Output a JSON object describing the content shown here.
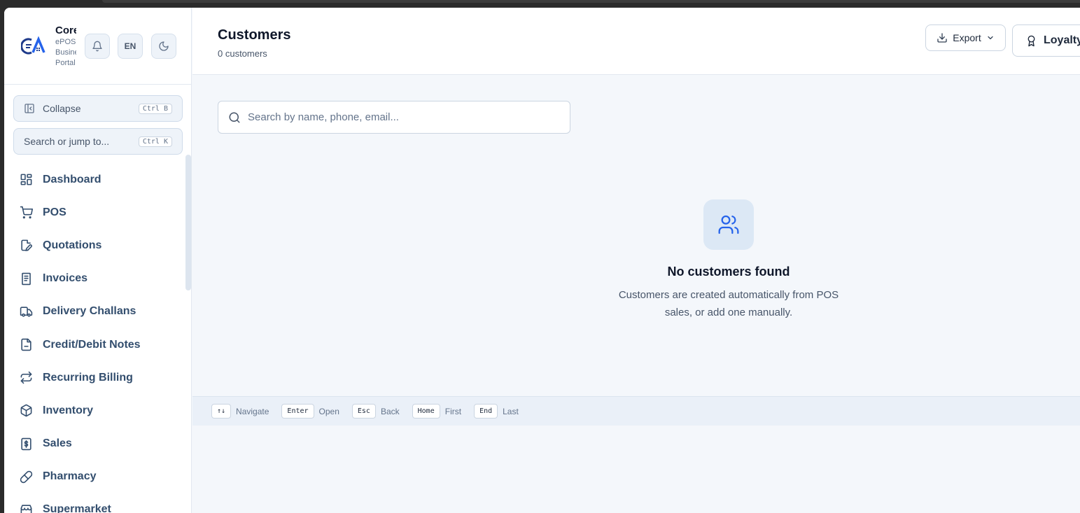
{
  "brand": {
    "name": "Core",
    "sub_lines": [
      "ePOS",
      "Business",
      "Portal"
    ]
  },
  "header_buttons": {
    "language": "EN"
  },
  "sidebar": {
    "collapse_label": "Collapse",
    "collapse_shortcut": "Ctrl B",
    "search_label": "Search or jump to...",
    "search_shortcut": "Ctrl K",
    "items": [
      {
        "label": "Dashboard",
        "icon": "dashboard-icon"
      },
      {
        "label": "POS",
        "icon": "cart-icon"
      },
      {
        "label": "Quotations",
        "icon": "edit-document-icon"
      },
      {
        "label": "Invoices",
        "icon": "receipt-icon"
      },
      {
        "label": "Delivery Challans",
        "icon": "truck-icon"
      },
      {
        "label": "Credit/Debit Notes",
        "icon": "file-icon"
      },
      {
        "label": "Recurring Billing",
        "icon": "repeat-icon"
      },
      {
        "label": "Inventory",
        "icon": "box-icon"
      },
      {
        "label": "Sales",
        "icon": "dollar-icon"
      },
      {
        "label": "Pharmacy",
        "icon": "pill-icon"
      },
      {
        "label": "Supermarket",
        "icon": "store-icon"
      }
    ]
  },
  "page": {
    "title": "Customers",
    "subtitle": "0 customers",
    "export_label": "Export",
    "loyalty_label": "Loyalty"
  },
  "search": {
    "placeholder": "Search by name, phone, email..."
  },
  "empty_state": {
    "title": "No customers found",
    "description": "Customers are created automatically from POS sales, or add one manually."
  },
  "keyboard_hints": [
    {
      "key": "↑↓",
      "label": "Navigate"
    },
    {
      "key": "Enter",
      "label": "Open"
    },
    {
      "key": "Esc",
      "label": "Back"
    },
    {
      "key": "Home",
      "label": "First"
    },
    {
      "key": "End",
      "label": "Last"
    }
  ],
  "colors": {
    "accent": "#2563eb",
    "nav_text": "#334e6e"
  }
}
